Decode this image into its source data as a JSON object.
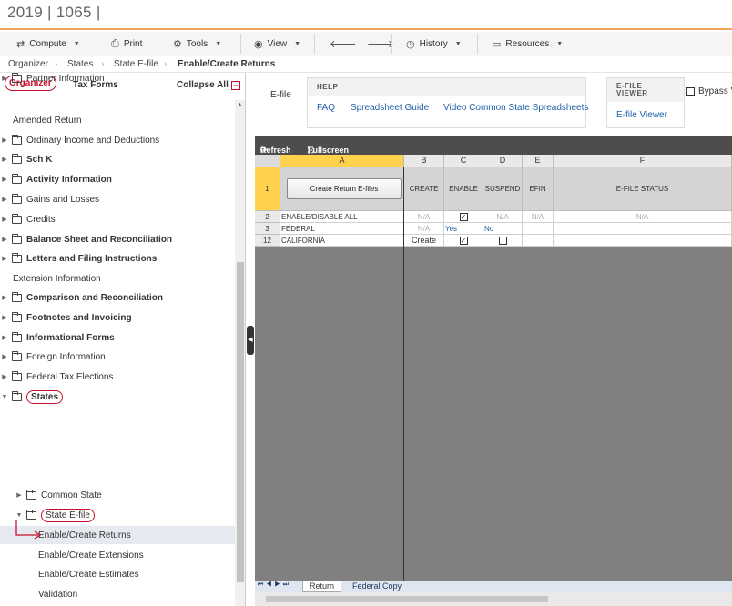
{
  "window": {
    "title": "2019 | 1065 |"
  },
  "toolbar": {
    "compute": "Compute",
    "print": "Print",
    "tools": "Tools",
    "view": "View",
    "history": "History",
    "resources": "Resources"
  },
  "breadcrumb": [
    "Organizer",
    "States",
    "State E-file",
    "Enable/Create Returns"
  ],
  "left_tabs": {
    "organizer": "Organizer",
    "tax_forms": "Tax Forms",
    "collapse_all": "Collapse All"
  },
  "tree": [
    {
      "label": "Partner Information",
      "bold": false,
      "folder": true
    },
    {
      "label": "Amended Return",
      "bold": false,
      "folder": false
    },
    {
      "label": "Ordinary Income and Deductions",
      "bold": false,
      "folder": true
    },
    {
      "label": "Sch K",
      "bold": true,
      "folder": true
    },
    {
      "label": "Activity Information",
      "bold": true,
      "folder": true
    },
    {
      "label": "Gains and Losses",
      "bold": false,
      "folder": true
    },
    {
      "label": "Credits",
      "bold": false,
      "folder": true
    },
    {
      "label": "Balance Sheet and Reconciliation",
      "bold": true,
      "folder": true
    },
    {
      "label": "Letters and Filing Instructions",
      "bold": true,
      "folder": true
    },
    {
      "label": "Extension Information",
      "bold": false,
      "folder": false
    },
    {
      "label": "Comparison and Reconciliation",
      "bold": true,
      "folder": true
    },
    {
      "label": "Footnotes and Invoicing",
      "bold": true,
      "folder": true
    },
    {
      "label": "Informational Forms",
      "bold": true,
      "folder": true
    },
    {
      "label": "Foreign Information",
      "bold": false,
      "folder": true
    },
    {
      "label": "Federal Tax Elections",
      "bold": false,
      "folder": true
    },
    {
      "label": "States",
      "bold": true,
      "folder": true
    },
    {
      "label": "Common State",
      "bold": false,
      "folder": true
    },
    {
      "label": "State E-file",
      "bold": false,
      "folder": true
    },
    {
      "label": "Enable/Create Returns",
      "bold": false,
      "folder": false
    },
    {
      "label": "Enable/Create Extensions",
      "bold": false,
      "folder": false
    },
    {
      "label": "Enable/Create Estimates",
      "bold": false,
      "folder": false
    },
    {
      "label": "Validation",
      "bold": false,
      "folder": false
    }
  ],
  "efile": {
    "label": "E-file",
    "help_header": "HELP",
    "help_links": [
      "FAQ",
      "Spreadsheet Guide",
      "Video Common State Spreadsheets"
    ],
    "viewer_header_1": "E-FILE",
    "viewer_header_2": "VIEWER",
    "viewer_link": "E-file Viewer",
    "bypass": "Bypass V"
  },
  "grid": {
    "refresh": "Refresh",
    "fullscreen": "Fullscreen",
    "columns": [
      "A",
      "B",
      "C",
      "D",
      "E",
      "F"
    ],
    "row1": {
      "num": "1",
      "button": "Create Return E-files",
      "create": "CREATE",
      "enable": "ENABLE",
      "suspend": "SUSPEND",
      "efin": "EFIN",
      "status": "E-FILE STATUS"
    },
    "rows": [
      {
        "num": "2",
        "name": "ENABLE/DISABLE ALL",
        "create": "N/A",
        "enable_checked": true,
        "suspend": "N/A",
        "efin": "N/A",
        "status": "N/A"
      },
      {
        "num": "3",
        "name": "FEDERAL",
        "create": "N/A",
        "enable": "Yes",
        "suspend": "No",
        "efin": "",
        "status": ""
      },
      {
        "num": "12",
        "name": "CALIFORNIA",
        "create": "Create",
        "enable_checked": true,
        "suspend_checked": false,
        "efin": "",
        "status": ""
      }
    ],
    "sheet_tabs": [
      "Return",
      "Federal Copy"
    ]
  }
}
